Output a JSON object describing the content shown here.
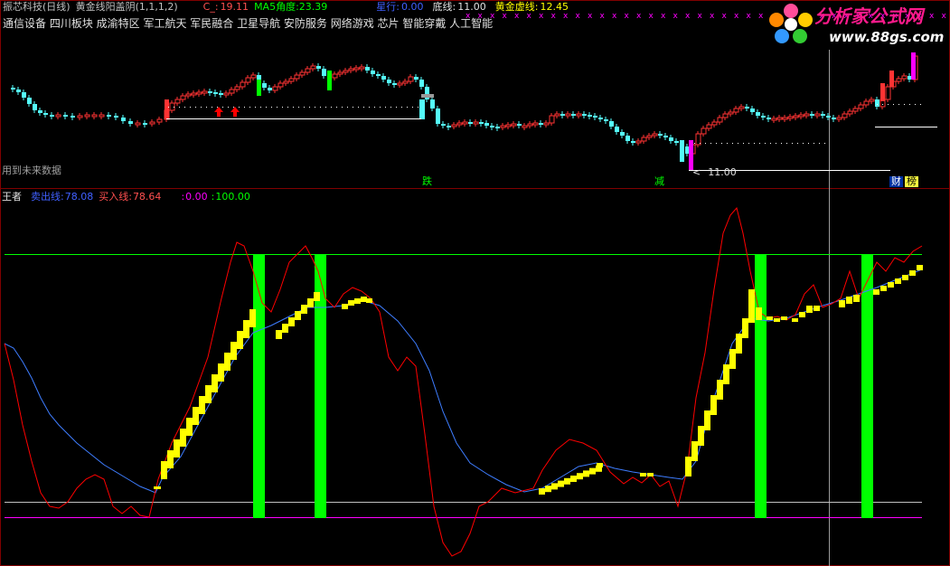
{
  "header": {
    "name": "振芯科技",
    "period": "(日线)",
    "indicator": "黄金线阳盖阴",
    "params": "(1,1,1,2)",
    "c_label": "C_:",
    "c_value": "19.11",
    "ma5_label": "MA5角度:",
    "ma5_value": "23.39",
    "xingxing_label": "星行:",
    "xingxing_value": "0.00",
    "dixian_label": "底线:",
    "dixian_value": "11.00",
    "huangjin_label": "黄金虚线:",
    "huangjin_value": "12.45"
  },
  "concepts": "通信设备 四川板块 成渝特区 军工航天 军民融合 卫星导航 安防服务 网络游戏 芯片 智能穿戴 人工智能",
  "future_data_note": "用到未来数据",
  "markers": {
    "die": "跌",
    "jian": "减",
    "cai": "财",
    "bang": "榜",
    "price_pointer": "11.00"
  },
  "lower_header": {
    "title": "王者",
    "sell_label": "卖出线:",
    "sell_value": "78.08",
    "buy_label": "买入线:",
    "buy_value": "78.64",
    "colon": ":",
    "v1": "0.00",
    "v2": "100.00"
  },
  "logo": {
    "text": "分析家公式网",
    "url": "www.88gs.com"
  },
  "colors": {
    "bg": "#000000",
    "up": "#ff3333",
    "down": "#54fcfc",
    "header_text": "#c0c0c0",
    "yellow": "#ffff00",
    "green": "#00ff00",
    "red_line": "#ff0000",
    "blue_line": "#3e7dff",
    "magenta": "#ff00ff",
    "white_line": "#ffffff",
    "divider": "#800000"
  }
}
